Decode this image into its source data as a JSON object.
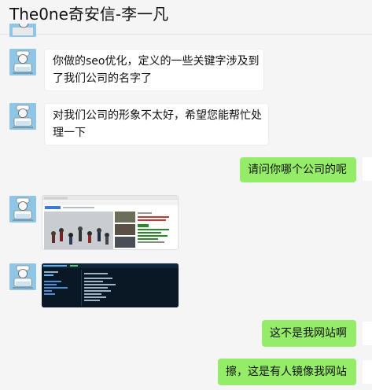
{
  "header": {
    "title": "The0ne奇安信-李一凡"
  },
  "messages": [
    {
      "side": "in",
      "lines": [
        "你做的seo优化，定义的一些关键字涉及到",
        "了我们公司的名字了"
      ]
    },
    {
      "side": "in",
      "lines": [
        "对我们公司的形象不太好，希望您能帮忙处",
        "理一下"
      ]
    },
    {
      "side": "out",
      "lines": [
        "请问你哪个公司的呢"
      ]
    },
    {
      "side": "in",
      "kind": "image",
      "description": "website-screenshot"
    },
    {
      "side": "in",
      "kind": "image",
      "description": "terminal-screenshot"
    },
    {
      "side": "out",
      "lines": [
        "这不是我网站啊"
      ]
    },
    {
      "side": "out",
      "lines": [
        "擦，这是有人镜像我网站"
      ]
    }
  ],
  "colors": {
    "incoming": "#ffffff",
    "outgoing": "#95ec69",
    "background": "#f5f5f5"
  }
}
